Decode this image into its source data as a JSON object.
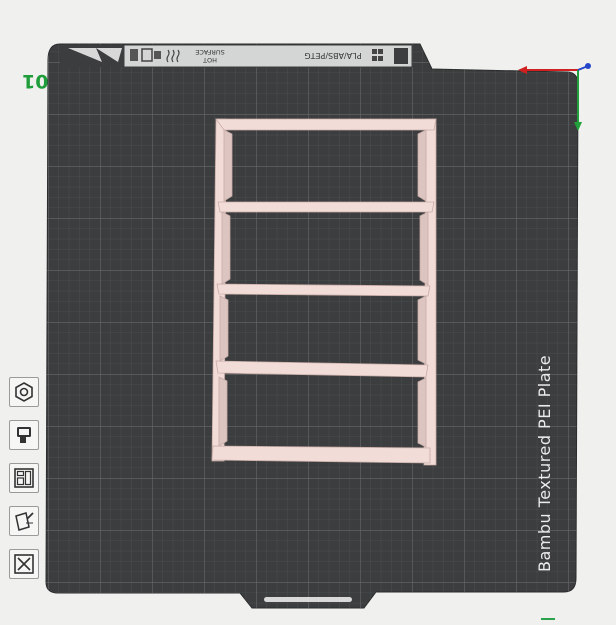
{
  "plate": {
    "number": "01",
    "name": "Bambu Textured PEI Plate",
    "tab_materials": "PLA/ABS/PETG",
    "tab_surface_line1": "HOT",
    "tab_surface_line2": "SURFACE",
    "colors": {
      "background": "#f0f1ee",
      "plate": "#3b3d3e",
      "grid": "#5a5c5d",
      "model": "#f2dcd8",
      "axis_x": "#d0201f",
      "axis_y": "#22a03a",
      "axis_z": "#2546c8",
      "plate_number": "#1f9d3a"
    }
  },
  "model": {
    "name": "shelf-model",
    "shelves": 5
  },
  "toolbar": {
    "tools": [
      {
        "name": "orient-tool",
        "icon": "hexagon-icon"
      },
      {
        "name": "support-paint-tool",
        "icon": "paint-bucket-icon"
      },
      {
        "name": "arrange-tool",
        "icon": "arrange-icon"
      },
      {
        "name": "seam-paint-tool",
        "icon": "seam-brush-icon"
      },
      {
        "name": "cut-tool",
        "icon": "x-box-icon"
      }
    ]
  }
}
